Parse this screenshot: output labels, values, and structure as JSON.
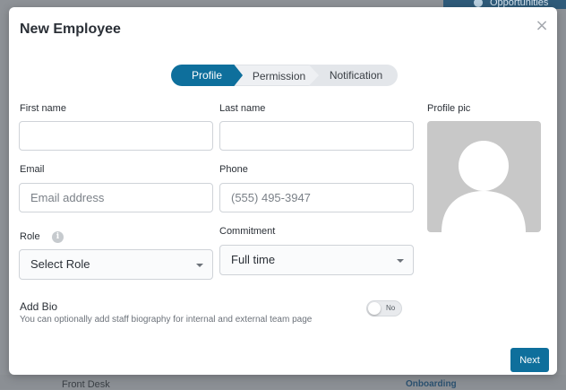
{
  "background": {
    "top_button": "Opportunities",
    "row_left": "Front Desk",
    "row_right": "Onboarding"
  },
  "modal": {
    "title": "New Employee",
    "close_glyph": "×"
  },
  "stepper": {
    "steps": [
      {
        "label": "Profile",
        "active": true
      },
      {
        "label": "Permission",
        "active": false
      },
      {
        "label": "Notification",
        "active": false
      }
    ]
  },
  "form": {
    "first_name": {
      "label": "First name",
      "value": "",
      "placeholder": ""
    },
    "last_name": {
      "label": "Last name",
      "value": "",
      "placeholder": ""
    },
    "email": {
      "label": "Email",
      "value": "",
      "placeholder": "Email address"
    },
    "phone": {
      "label": "Phone",
      "value": "",
      "placeholder": "(555) 495-3947"
    },
    "role": {
      "label": "Role",
      "info_glyph": "i",
      "selected": "Select Role"
    },
    "commitment": {
      "label": "Commitment",
      "selected": "Full time"
    },
    "profile_pic": {
      "label": "Profile pic",
      "icon": "user-silhouette"
    }
  },
  "bio": {
    "title": "Add Bio",
    "description": "You can optionally add staff biography for internal and external team page",
    "toggle_label": "No",
    "toggle_on": false
  },
  "actions": {
    "next_label": "Next"
  },
  "colors": {
    "primary": "#0e6f9c",
    "avatar_bg": "#c8c8c8",
    "border": "#cfd3d8"
  }
}
